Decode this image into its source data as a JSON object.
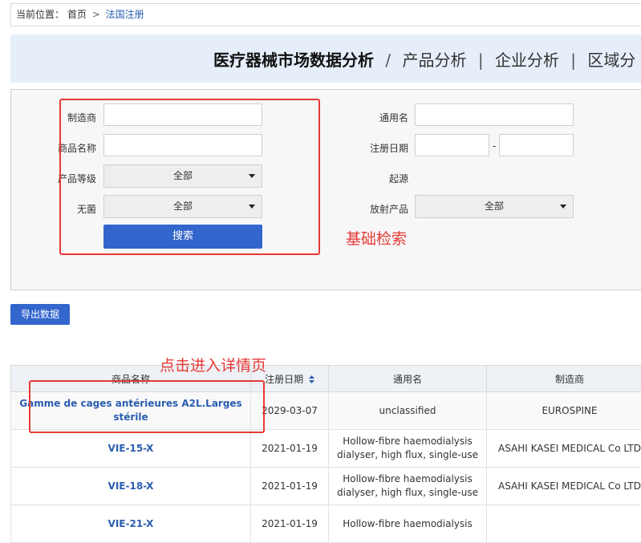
{
  "breadcrumb": {
    "prefix": "当前位置：",
    "home": "首页",
    "separator": ">",
    "current": "法国注册"
  },
  "banner": {
    "title": "医疗器械市场数据分析",
    "divider": "/",
    "links": [
      "产品分析",
      "企业分析",
      "区域分"
    ]
  },
  "search": {
    "left": {
      "manufacturer_label": "制造商",
      "manufacturer_value": "",
      "product_name_label": "商品名称",
      "product_name_value": "",
      "product_class_label": "产品等级",
      "product_class_value": "全部",
      "sterile_label": "无菌",
      "sterile_value": "全部"
    },
    "right": {
      "generic_name_label": "通用名",
      "generic_name_value": "",
      "reg_date_label": "注册日期",
      "reg_date_from": "",
      "reg_date_sep": "-",
      "reg_date_to": "",
      "origin_label": "起源",
      "radiation_label": "放射产品",
      "radiation_value": "全部"
    },
    "search_button": "搜索"
  },
  "annotations": {
    "basic_search": "基础检索",
    "detail_hint": "点击进入详情页"
  },
  "export_button": "导出数据",
  "table": {
    "headers": [
      "商品名称",
      "注册日期",
      "通用名",
      "制造商"
    ],
    "rows": [
      {
        "name": "Gamme de cages antérieures A2L.Larges stérile",
        "date": "2029-03-07",
        "generic": "unclassified",
        "maker": "EUROSPINE"
      },
      {
        "name": "VIE-15-X",
        "date": "2021-01-19",
        "generic": "Hollow-fibre haemodialysis dialyser, high flux, single-use",
        "maker": "ASAHI KASEI MEDICAL Co LTD"
      },
      {
        "name": "VIE-18-X",
        "date": "2021-01-19",
        "generic": "Hollow-fibre haemodialysis dialyser, high flux, single-use",
        "maker": "ASAHI KASEI MEDICAL Co LTD"
      },
      {
        "name": "VIE-21-X",
        "date": "2021-01-19",
        "generic": "Hollow-fibre haemodialysis",
        "maker": ""
      }
    ]
  },
  "colors": {
    "accent": "#3366cc",
    "annotation": "#e53935",
    "link": "#2a5db0"
  }
}
